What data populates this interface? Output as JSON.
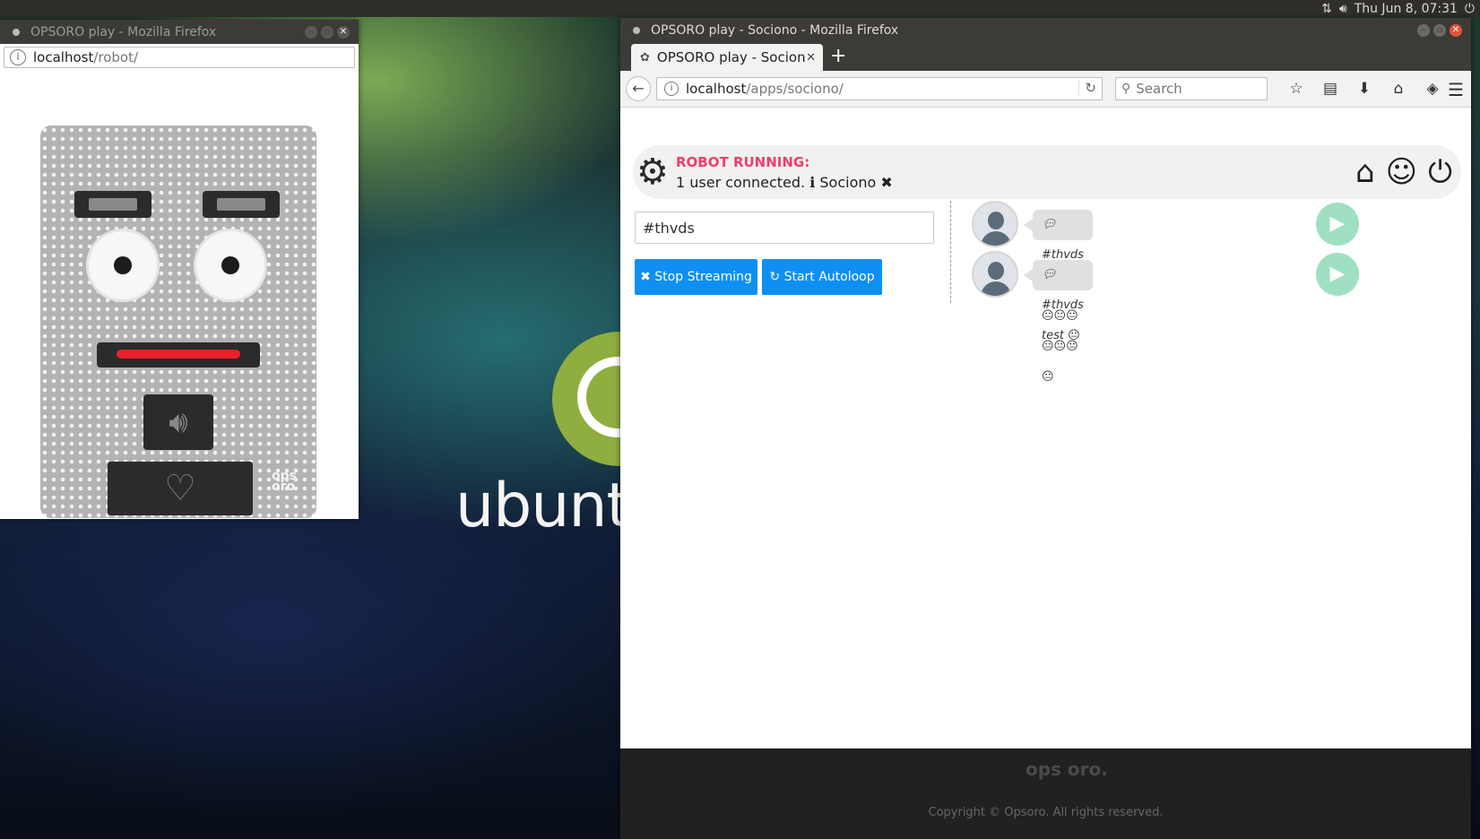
{
  "desktop": {
    "wallpaper_text": "ubuntu"
  },
  "top_panel": {
    "clock": "Thu Jun  8, 07:31"
  },
  "left_window": {
    "title": "OPSORO play - Mozilla Firefox",
    "url_host": "localhost",
    "url_path": "/robot/"
  },
  "right_window": {
    "title": "OPSORO play - Sociono - Mozilla Firefox",
    "tab_label": "OPSORO play - Sociono",
    "url_host": "localhost",
    "url_path": "/apps/sociono/",
    "search_placeholder": "Search",
    "status": {
      "title": "ROBOT RUNNING:",
      "line": "1 user connected.",
      "app_name": "Sociono"
    },
    "hashtag": "#thvds",
    "buttons": {
      "stop_streaming": "Stop Streaming",
      "start_autoloop": "Start Autoloop"
    },
    "posts": [
      {
        "text": "#thvds test 2 😐😐😐😐😐😐😐"
      },
      {
        "text": "#thvds test 😐"
      }
    ],
    "footer": {
      "logo": "ops oro.",
      "copyright": "Copyright © Opsoro. All rights reserved."
    }
  }
}
